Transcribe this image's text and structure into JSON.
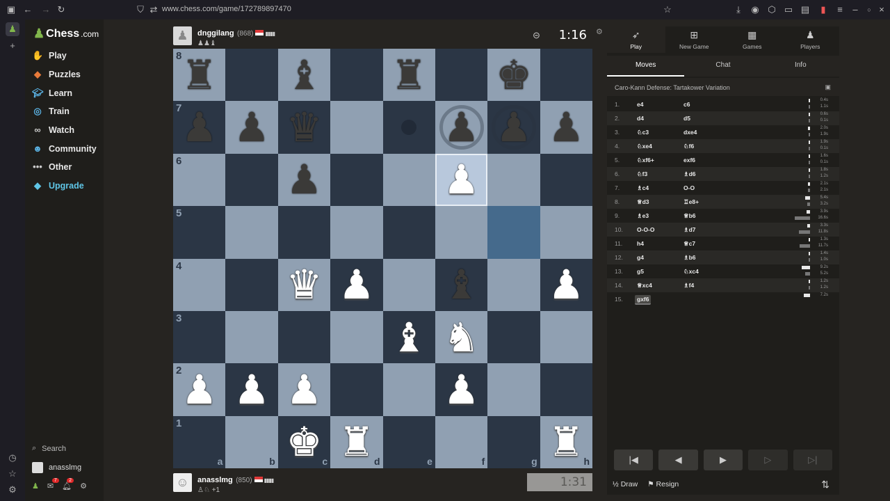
{
  "browser": {
    "url": "www.chess.com/game/172789897470"
  },
  "nav": {
    "logo": "Chess",
    "logo_suffix": ".com",
    "items": [
      {
        "label": "Play"
      },
      {
        "label": "Puzzles"
      },
      {
        "label": "Learn"
      },
      {
        "label": "Train"
      },
      {
        "label": "Watch"
      },
      {
        "label": "Community"
      },
      {
        "label": "Other"
      },
      {
        "label": "Upgrade"
      }
    ],
    "search": "Search",
    "user": "anasslmg",
    "mail_badge": "7",
    "notif_badge": "2"
  },
  "top_player": {
    "name": "dnggilang",
    "rating": "(868)",
    "captured": "♟♟♝",
    "clock": "1:16"
  },
  "bottom_player": {
    "name": "anasslmg",
    "rating": "(850)",
    "captured": "♙♘",
    "extra": "+1",
    "clock": "1:31"
  },
  "board": {
    "ranks": [
      "8",
      "7",
      "6",
      "5",
      "4",
      "3",
      "2",
      "1"
    ],
    "files": [
      "a",
      "b",
      "c",
      "d",
      "e",
      "f",
      "g",
      "h"
    ],
    "position": [
      [
        "r",
        "",
        "b",
        "",
        "r",
        "",
        "k",
        ""
      ],
      [
        "p",
        "p",
        "q",
        "",
        "",
        "p",
        "p",
        "p"
      ],
      [
        "",
        "",
        "p",
        "",
        "",
        "P",
        "",
        ""
      ],
      [
        "",
        "",
        "",
        "",
        "",
        "",
        "",
        ""
      ],
      [
        "",
        "",
        "Q",
        "P",
        "",
        "b",
        "",
        "P"
      ],
      [
        "",
        "",
        "",
        "",
        "B",
        "N",
        "",
        ""
      ],
      [
        "P",
        "P",
        "P",
        "",
        "",
        "P",
        "",
        ""
      ],
      [
        "",
        "",
        "K",
        "R",
        "",
        "",
        "",
        "R"
      ]
    ]
  },
  "panel": {
    "tabs": [
      {
        "label": "Play",
        "icon": "play-icon"
      },
      {
        "label": "New Game",
        "icon": "plus-icon"
      },
      {
        "label": "Games",
        "icon": "board-icon"
      },
      {
        "label": "Players",
        "icon": "players-icon"
      }
    ],
    "subtabs": [
      "Moves",
      "Chat",
      "Info"
    ],
    "opening": "Caro-Kann Defense: Tartakower Variation",
    "moves": [
      {
        "n": "1.",
        "w": "e4",
        "b": "c6",
        "tw": "0.4s",
        "tb": "1.1s",
        "ww": 0.03,
        "wb": 0.07
      },
      {
        "n": "2.",
        "w": "d4",
        "b": "d5",
        "tw": "0.6s",
        "tb": "0.1s",
        "ww": 0.04,
        "wb": 0.01
      },
      {
        "n": "3.",
        "w": "♘c3",
        "b": "dxe4",
        "tw": "2.0s",
        "tb": "1.9s",
        "ww": 0.12,
        "wb": 0.11
      },
      {
        "n": "4.",
        "w": "♘xe4",
        "b": "♘f6",
        "tw": "1.9s",
        "tb": "0.1s",
        "ww": 0.11,
        "wb": 0.01
      },
      {
        "n": "5.",
        "w": "♘xf6+",
        "b": "exf6",
        "tw": "1.6s",
        "tb": "0.1s",
        "ww": 0.1,
        "wb": 0.01
      },
      {
        "n": "6.",
        "w": "♘f3",
        "b": "♗d6",
        "tw": "1.8s",
        "tb": "1.2s",
        "ww": 0.11,
        "wb": 0.07
      },
      {
        "n": "7.",
        "w": "♗c4",
        "b": "O-O",
        "tw": "2.1s",
        "tb": "2.1s",
        "ww": 0.13,
        "wb": 0.13
      },
      {
        "n": "8.",
        "w": "♕d3",
        "b": "♖e8+",
        "tw": "5.4s",
        "tb": "3.2s",
        "ww": 0.33,
        "wb": 0.19
      },
      {
        "n": "9.",
        "w": "♗e3",
        "b": "♕b6",
        "tw": "3.9s",
        "tb": "16.6s",
        "ww": 0.24,
        "wb": 1.0
      },
      {
        "n": "10.",
        "w": "O-O-O",
        "b": "♗d7",
        "tw": "3.3s",
        "tb": "11.8s",
        "ww": 0.2,
        "wb": 0.71
      },
      {
        "n": "11.",
        "w": "h4",
        "b": "♕c7",
        "tw": "1.3s",
        "tb": "11.7s",
        "ww": 0.08,
        "wb": 0.7
      },
      {
        "n": "12.",
        "w": "g4",
        "b": "♗b6",
        "tw": "1.4s",
        "tb": "1.0s",
        "ww": 0.08,
        "wb": 0.06
      },
      {
        "n": "13.",
        "w": "g5",
        "b": "♘xc4",
        "tw": "9.2s",
        "tb": "5.2s",
        "ww": 0.55,
        "wb": 0.31
      },
      {
        "n": "14.",
        "w": "♕xc4",
        "b": "♗f4",
        "tw": "1.2s",
        "tb": "1.2s",
        "ww": 0.07,
        "wb": 0.07
      },
      {
        "n": "15.",
        "w": "gxf6",
        "b": "",
        "tw": "7.2s",
        "tb": "",
        "ww": 0.43,
        "wb": 0
      }
    ],
    "draw": "Draw",
    "resign": "Resign",
    "half": "½"
  }
}
